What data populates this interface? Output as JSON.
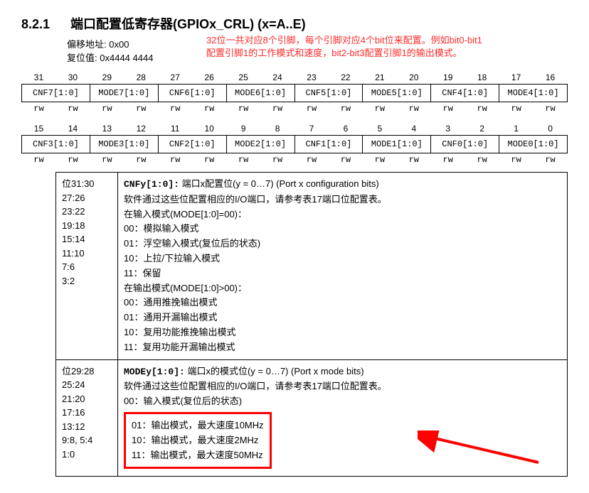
{
  "section": {
    "number": "8.2.1",
    "title": "端口配置低寄存器(GPIOx_CRL) (x=A..E)",
    "offset_label": "偏移地址:",
    "offset_value": "0x00",
    "reset_label": "复位值:",
    "reset_value": "0x4444 4444",
    "annotation1": "32位一共对应8个引脚，每个引脚对应4个bit位来配置。例如bit0-bit1",
    "annotation2": "配置引脚1的工作模式和速度，bit2-bit3配置引脚1的输出模式。"
  },
  "bits_high": {
    "nums": [
      "31",
      "30",
      "29",
      "28",
      "27",
      "26",
      "25",
      "24",
      "23",
      "22",
      "21",
      "20",
      "19",
      "18",
      "17",
      "16"
    ],
    "cells": [
      "CNF7[1:0]",
      "MODE7[1:0]",
      "CNF6[1:0]",
      "MODE6[1:0]",
      "CNF5[1:0]",
      "MODE5[1:0]",
      "CNF4[1:0]",
      "MODE4[1:0]"
    ],
    "rw": [
      "rw",
      "rw",
      "rw",
      "rw",
      "rw",
      "rw",
      "rw",
      "rw",
      "rw",
      "rw",
      "rw",
      "rw",
      "rw",
      "rw",
      "rw",
      "rw"
    ]
  },
  "bits_low": {
    "nums": [
      "15",
      "14",
      "13",
      "12",
      "11",
      "10",
      "9",
      "8",
      "7",
      "6",
      "5",
      "4",
      "3",
      "2",
      "1",
      "0"
    ],
    "cells": [
      "CNF3[1:0]",
      "MODE3[1:0]",
      "CNF2[1:0]",
      "MODE2[1:0]",
      "CNF1[1:0]",
      "MODE1[1:0]",
      "CNF0[1:0]",
      "MODE0[1:0]"
    ],
    "rw": [
      "rw",
      "rw",
      "rw",
      "rw",
      "rw",
      "rw",
      "rw",
      "rw",
      "rw",
      "rw",
      "rw",
      "rw",
      "rw",
      "rw",
      "rw",
      "rw"
    ]
  },
  "desc1": {
    "bits_label": "位31:30",
    "bits_list": [
      "27:26",
      "23:22",
      "19:18",
      "15:14",
      "11:10",
      "7:6",
      "3:2"
    ],
    "field": "CNFy[1:0]:",
    "field_title": "端口x配置位(y = 0…7) (Port x configuration bits)",
    "line1": "软件通过这些位配置相应的I/O端口，请参考表17端口位配置表。",
    "line2": "在输入模式(MODE[1:0]=00)：",
    "m00": "00：模拟输入模式",
    "m01": "01：浮空输入模式(复位后的状态)",
    "m10": "10：上拉/下拉输入模式",
    "m11": "11：保留",
    "line3": "在输出模式(MODE[1:0]>00)：",
    "o00": "00：通用推挽输出模式",
    "o01": "01：通用开漏输出模式",
    "o10": "10：复用功能推挽输出模式",
    "o11": "11：复用功能开漏输出模式"
  },
  "desc2": {
    "bits_label": "位29:28",
    "bits_list": [
      "25:24",
      "21:20",
      "17:16",
      "13:12",
      "9:8, 5:4",
      "1:0"
    ],
    "field": "MODEy[1:0]:",
    "field_title": "端口x的模式位(y = 0…7) (Port x mode bits)",
    "line1": "软件通过这些位配置相应的I/O端口，请参考表17端口位配置表。",
    "m00": "00：输入模式(复位后的状态)",
    "m01": "01：输出模式，最大速度10MHz",
    "m10": "10：输出模式，最大速度2MHz",
    "m11": "11：输出模式，最大速度50MHz"
  }
}
